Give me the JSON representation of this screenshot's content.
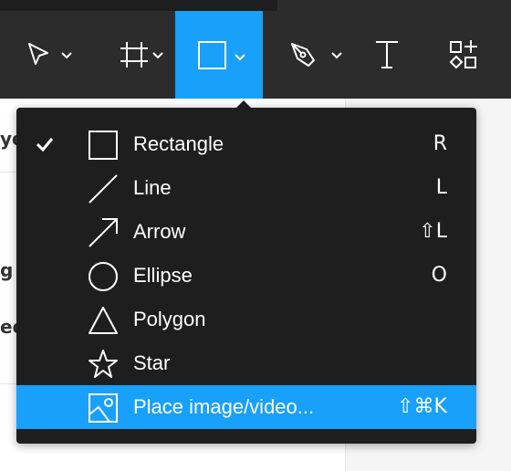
{
  "toolbar": {
    "tools": [
      {
        "id": "move",
        "icon": "move-cursor-icon",
        "has_dropdown": true
      },
      {
        "id": "frame",
        "icon": "frame-hash-icon",
        "has_dropdown": true
      },
      {
        "id": "shape",
        "icon": "rectangle-icon",
        "has_dropdown": true,
        "active": true
      },
      {
        "id": "pen",
        "icon": "pen-nib-icon",
        "has_dropdown": true
      },
      {
        "id": "text",
        "icon": "text-t-icon",
        "has_dropdown": false
      },
      {
        "id": "resources",
        "icon": "shapes-plus-icon",
        "has_dropdown": false
      }
    ],
    "active_color": "#18a0fb"
  },
  "background": {
    "fragments": [
      "ye",
      "g",
      "ee"
    ]
  },
  "menu": {
    "items": [
      {
        "label": "Rectangle",
        "shortcut": "R",
        "icon": "rectangle-icon",
        "checked": true
      },
      {
        "label": "Line",
        "shortcut": "L",
        "icon": "line-icon"
      },
      {
        "label": "Arrow",
        "shortcut": "⇧L",
        "icon": "arrow-icon"
      },
      {
        "label": "Ellipse",
        "shortcut": "O",
        "icon": "ellipse-icon"
      },
      {
        "label": "Polygon",
        "shortcut": "",
        "icon": "polygon-icon"
      },
      {
        "label": "Star",
        "shortcut": "",
        "icon": "star-icon"
      },
      {
        "label": "Place image/video...",
        "shortcut": "⇧⌘K",
        "icon": "image-icon",
        "highlighted": true
      }
    ]
  },
  "colors": {
    "menu_bg": "#1e1e1e",
    "toolbar_bg": "#2c2c2c",
    "highlight": "#18a0fb"
  }
}
